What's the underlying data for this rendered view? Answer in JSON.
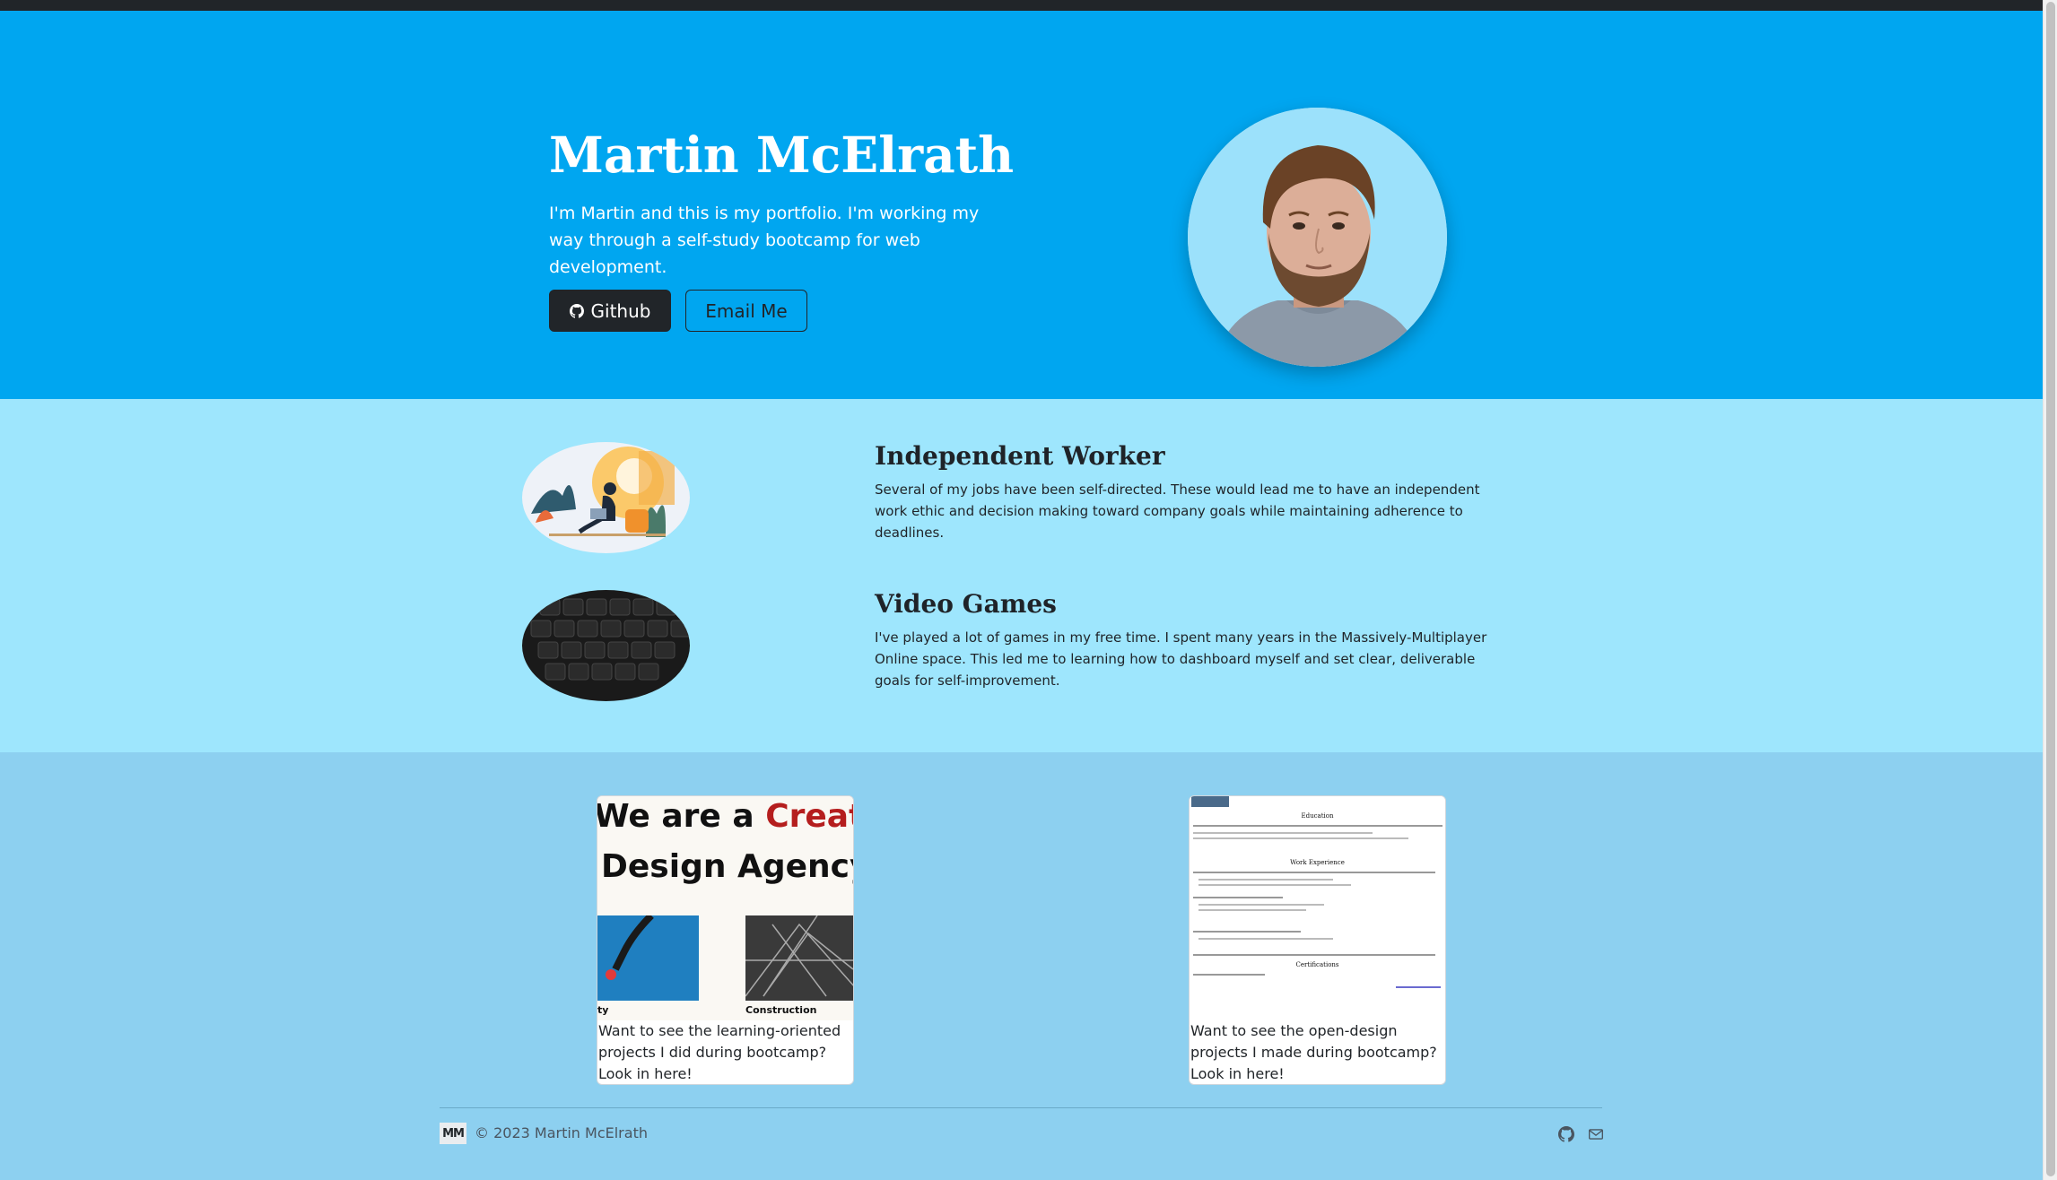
{
  "hero": {
    "title": "Martin McElrath",
    "description": "I'm Martin and this is my portfolio. I'm working my way through a self-study bootcamp for web development.",
    "github_button": "Github",
    "email_button": "Email Me",
    "github_icon": "github-icon",
    "background_color": "#00a6f0"
  },
  "features": [
    {
      "title": "Independent Worker",
      "text": "Several of my jobs have been self-directed. These would lead me to have an independent work ethic and decision making toward company goals while maintaining adherence to deadlines."
    },
    {
      "title": "Video Games",
      "text": "I've played a lot of games in my free time. I spent many years in the Massively-Multiplayer Online space. This led me to learning how to dashboard myself and set clear, deliverable goals for self-improvement."
    }
  ],
  "projects": [
    {
      "thumb_line1": "We are a ",
      "thumb_accent": "Creative",
      "thumb_line2": "Design Agency",
      "thumb_caption_left": "ty",
      "thumb_caption_right": "Construction",
      "text": "Want to see the learning-oriented projects I did during bootcamp? Look in here!"
    },
    {
      "thumb_heading1": "Education",
      "thumb_heading2": "Work Experience",
      "thumb_heading3": "Certifications",
      "text": "Want to see the open-design projects I made during bootcamp? Look in here!"
    }
  ],
  "footer": {
    "logo": "MM",
    "copyright": "© 2023 Martin McElrath",
    "icons": [
      "github-icon",
      "envelope-icon"
    ]
  },
  "colors": {
    "hero_bg": "#00a6f0",
    "features_bg": "#9ee6fd",
    "projects_bg": "#8dd0f0",
    "dark": "#212529"
  }
}
